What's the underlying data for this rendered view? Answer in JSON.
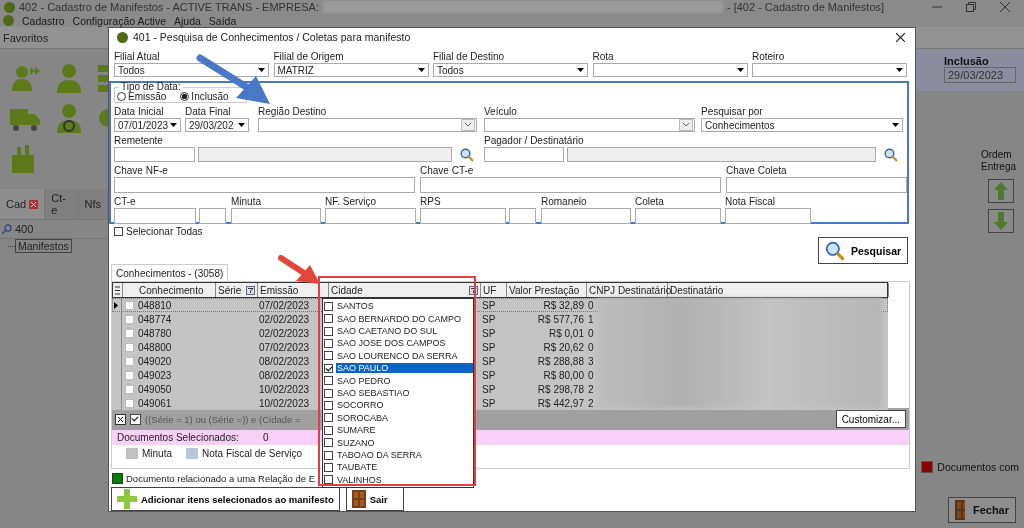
{
  "app": {
    "title_left": "402 - Cadastro de Manifestos - ACTIVE TRANS - EMPRESA:",
    "title_right": "- [402 - Cadastro de Manifestos]",
    "menu": [
      "Cadastro",
      "Configuração Active",
      "Ajuda",
      "Saída"
    ],
    "favorites": "Favoritos",
    "side_tabs": [
      {
        "label": "Cad",
        "selected": true
      },
      {
        "label": "Ct-e",
        "selected": false
      },
      {
        "label": "Nfs",
        "selected": false
      }
    ],
    "search_value": "400",
    "tree_item": "Manifestos",
    "inclusion_label": "Inclusão",
    "inclusion_value": "29/03/2023",
    "order_label": "Ordem Entrega",
    "legend": {
      "label": "Documentos com",
      "color": "#8b0000"
    },
    "close_button": "Fechar"
  },
  "dialog": {
    "title": "401 - Pesquisa de Conhecimentos / Coletas para manifesto",
    "top_selects": [
      {
        "label": "Filial Atual",
        "value": "Todos"
      },
      {
        "label": "Filial de Origem",
        "value": "MATRIZ"
      },
      {
        "label": "Filial de Destino",
        "value": "Todos"
      },
      {
        "label": "Rota"
      },
      {
        "label": "Roteiro"
      }
    ],
    "date_type": {
      "label": "Tipo de Data:",
      "options": [
        {
          "label": "Emissão",
          "selected": false
        },
        {
          "label": "Inclusão",
          "selected": true
        }
      ]
    },
    "date_start": {
      "label": "Data Inicial",
      "value": "07/01/2023"
    },
    "date_end": {
      "label": "Data Final",
      "value": "29/03/202"
    },
    "region": {
      "label": "Região Destino"
    },
    "vehicle": {
      "label": "Veículo"
    },
    "search_by": {
      "label": "Pesquisar por",
      "value": "Conhecimentos"
    },
    "sender": {
      "label": "Remetente"
    },
    "payer": {
      "label": "Pagador / Destinatário"
    },
    "keys": [
      {
        "label": "Chave NF-e"
      },
      {
        "label": "Chave CT-e"
      },
      {
        "label": "Chave Coleta"
      }
    ],
    "numbers": [
      {
        "label": "CT-e",
        "split": true
      },
      {
        "label": "Minuta",
        "split": false
      },
      {
        "label": "NF. Serviço",
        "split": false
      },
      {
        "label": "RPS",
        "split": true
      },
      {
        "label": "Romaneio",
        "split": false
      },
      {
        "label": "Coleta",
        "split": false
      },
      {
        "label": "Nota Fiscal",
        "split": false
      }
    ],
    "select_all": {
      "label": "Selecionar Todas",
      "checked": false
    },
    "search_button": "Pesquisar",
    "tab": "Conhecimentos - (3058)",
    "columns": [
      "Conhecimento",
      "Série",
      "Emissão",
      "Cidade",
      "UF",
      "Valor Prestação",
      "CNPJ Destinatário",
      "Destinatário"
    ],
    "rows": [
      {
        "number": "048810",
        "date": "07/02/2023",
        "uf": "SP",
        "value": "R$ 32,89",
        "cnpj": "0",
        "checked": false,
        "current": true
      },
      {
        "number": "048774",
        "date": "02/02/2023",
        "uf": "SP",
        "value": "R$ 577,76",
        "cnpj": "1",
        "checked": false,
        "current": false
      },
      {
        "number": "048780",
        "date": "02/02/2023",
        "uf": "SP",
        "value": "R$ 0,01",
        "cnpj": "0",
        "checked": false,
        "current": false
      },
      {
        "number": "048800",
        "date": "07/02/2023",
        "uf": "SP",
        "value": "R$ 20,62",
        "cnpj": "0",
        "checked": false,
        "current": false
      },
      {
        "number": "049020",
        "date": "08/02/2023",
        "uf": "SP",
        "value": "R$ 288,88",
        "cnpj": "3",
        "checked": false,
        "current": false
      },
      {
        "number": "049023",
        "date": "08/02/2023",
        "uf": "SP",
        "value": "R$ 80,00",
        "cnpj": "0",
        "checked": false,
        "current": false
      },
      {
        "number": "049050",
        "date": "10/02/2023",
        "uf": "SP",
        "value": "R$ 298,78",
        "cnpj": "2",
        "checked": false,
        "current": false
      },
      {
        "number": "049061",
        "date": "10/02/2023",
        "uf": "SP",
        "value": "R$ 442,97",
        "cnpj": "2",
        "checked": false,
        "current": false
      }
    ],
    "filter": {
      "text": "((Série = 1) ou (Série =)) e (Cidade =",
      "enabled": true
    },
    "customize_button": "Customizar...",
    "selected_docs": {
      "label": "Documentos Selecionados:",
      "count": "0"
    },
    "legend": [
      {
        "label": "Minuta",
        "color": "#c0c0c0"
      },
      {
        "label": "Nota Fiscal de Serviço",
        "color": "#b8c8d8"
      }
    ],
    "related": {
      "label": "Documento relacionado a uma Relação de E",
      "color": "#008000"
    },
    "add_button": "Adicionar itens selecionados ao manifesto",
    "exit_button": "Sair",
    "city_options": [
      {
        "label": "SANTOS",
        "checked": false,
        "selected": false
      },
      {
        "label": "SAO BERNARDO DO CAMPO",
        "checked": false,
        "selected": false
      },
      {
        "label": "SAO CAETANO DO SUL",
        "checked": false,
        "selected": false
      },
      {
        "label": "SAO JOSE DOS CAMPOS",
        "checked": false,
        "selected": false
      },
      {
        "label": "SAO LOURENCO DA SERRA",
        "checked": false,
        "selected": false
      },
      {
        "label": "SAO PAULO",
        "checked": true,
        "selected": true
      },
      {
        "label": "SAO PEDRO",
        "checked": false,
        "selected": false
      },
      {
        "label": "SAO SEBASTIAO",
        "checked": false,
        "selected": false
      },
      {
        "label": "SOCORRO",
        "checked": false,
        "selected": false
      },
      {
        "label": "SOROCABA",
        "checked": false,
        "selected": false
      },
      {
        "label": "SUMARE",
        "checked": false,
        "selected": false
      },
      {
        "label": "SUZANO",
        "checked": false,
        "selected": false
      },
      {
        "label": "TABOAO DA SERRA",
        "checked": false,
        "selected": false
      },
      {
        "label": "TAUBATE",
        "checked": false,
        "selected": false
      },
      {
        "label": "VALINHOS",
        "checked": false,
        "selected": false
      }
    ]
  }
}
